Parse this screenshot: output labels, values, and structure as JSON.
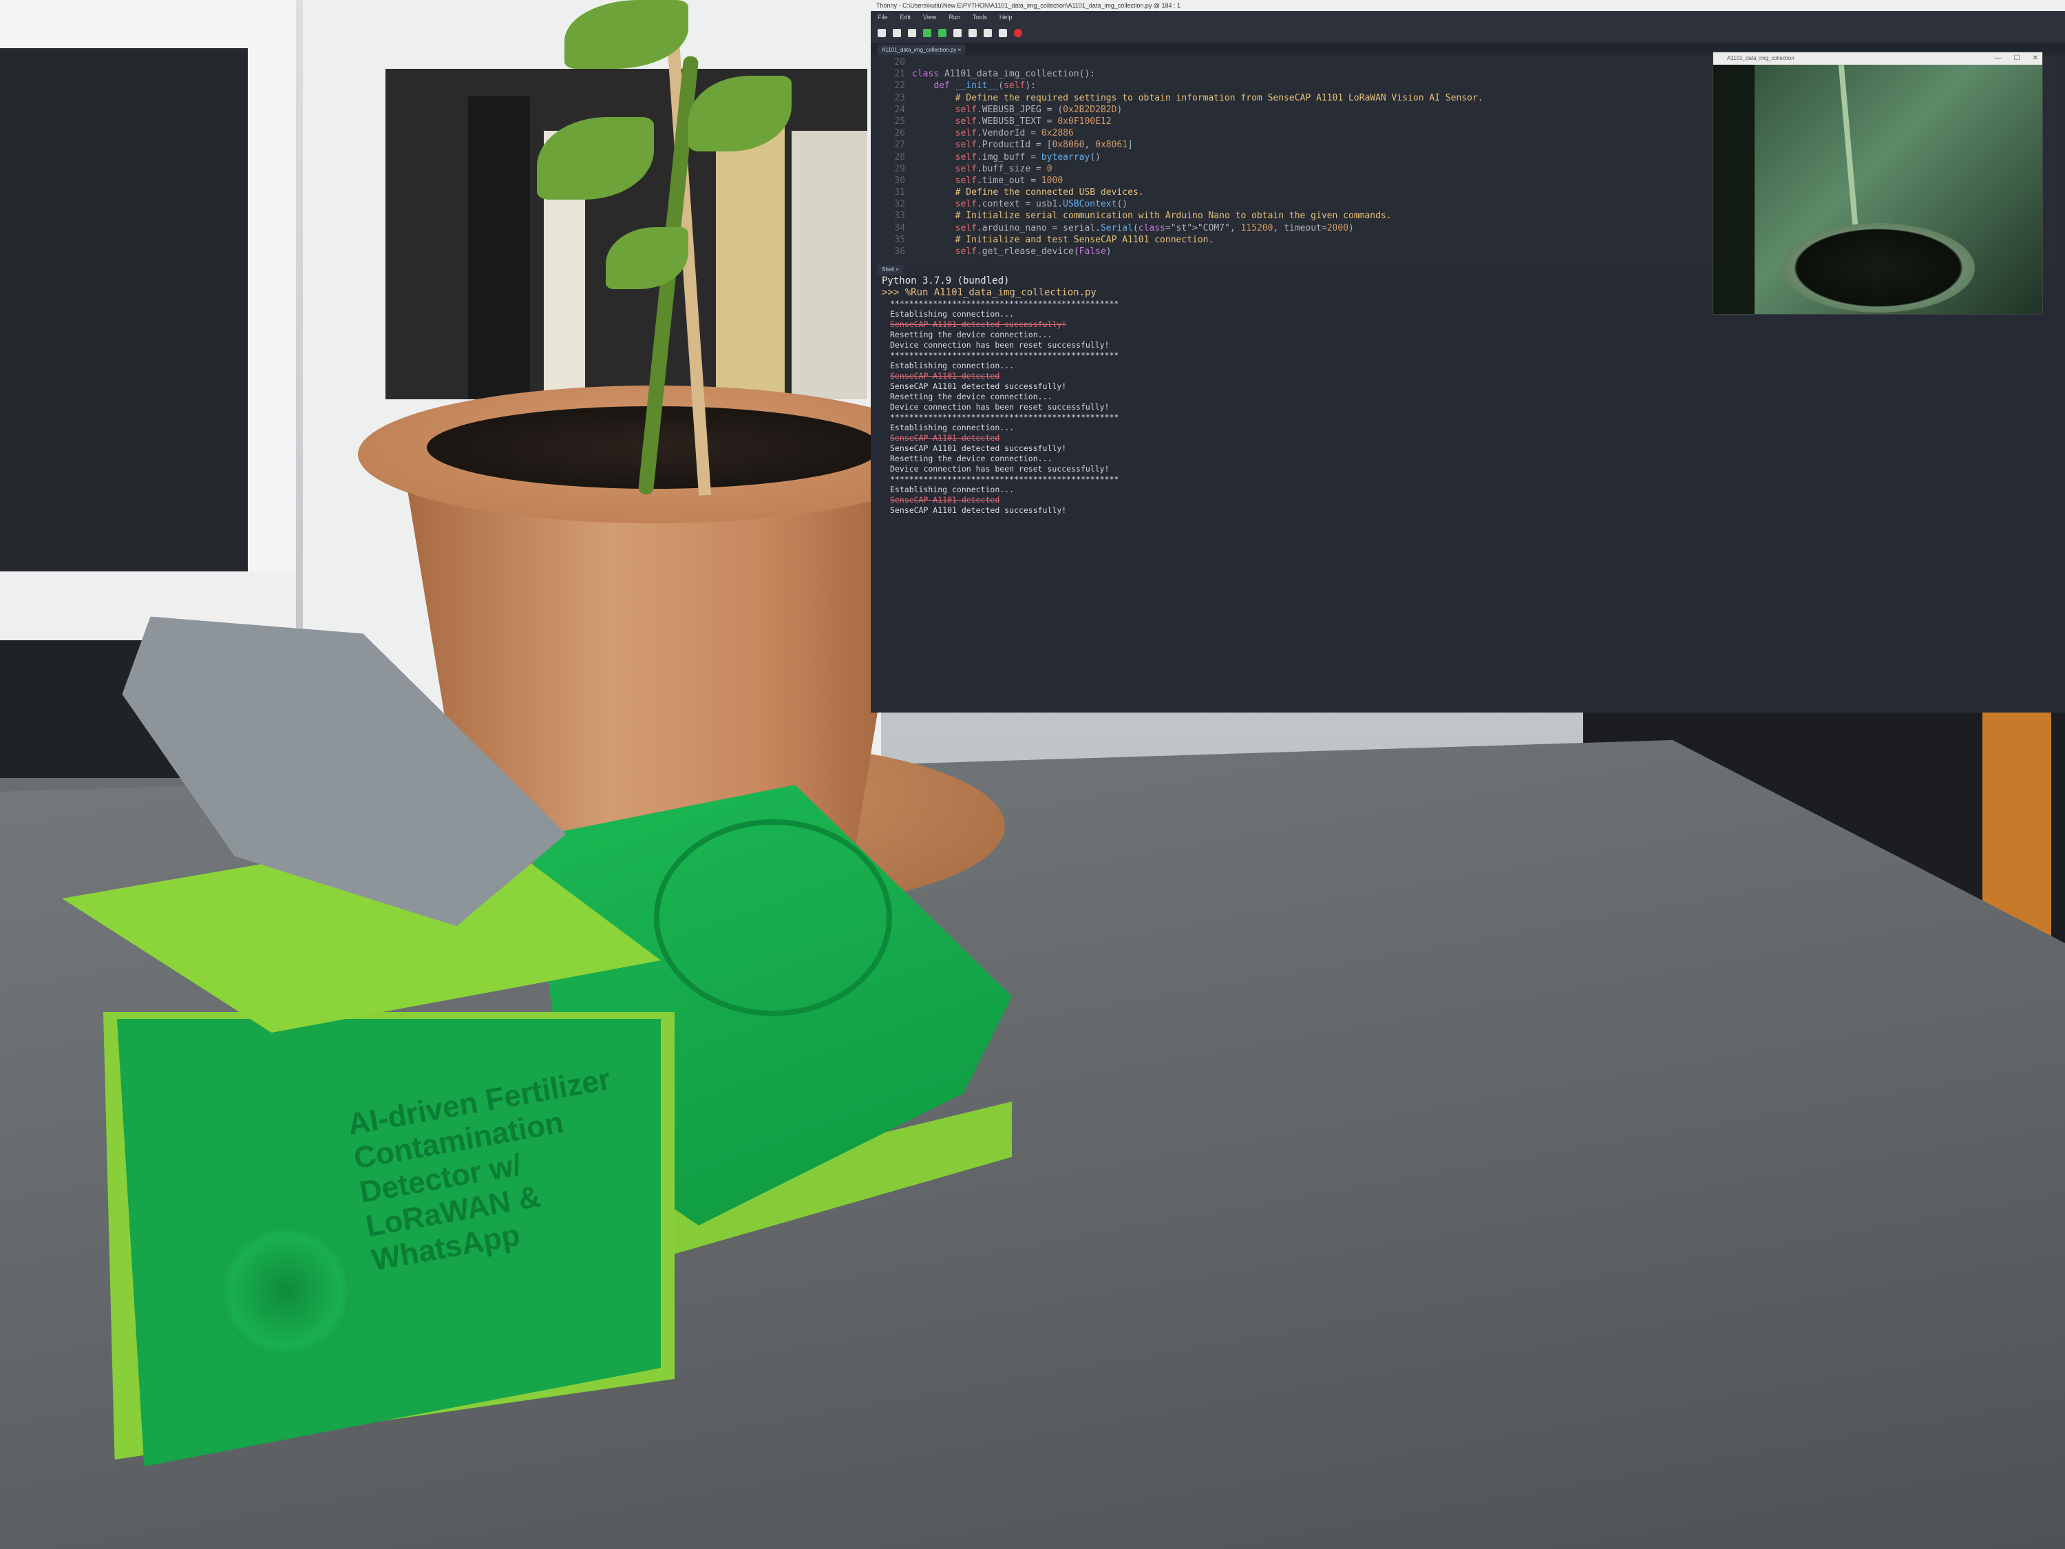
{
  "ide": {
    "title": "Thonny  -  C:\\Users\\kutlu\\New E\\PYTHON\\A1101_data_img_collection\\A1101_data_img_collection.py  @  184 : 1",
    "menu": [
      "File",
      "Edit",
      "View",
      "Run",
      "Tools",
      "Help"
    ],
    "file_tab": "A1101_data_img_collection.py ×",
    "shell_tab": "Shell ×",
    "code_lines": [
      {
        "n": "20",
        "text": ""
      },
      {
        "n": "21",
        "text": "class A1101_data_img_collection():"
      },
      {
        "n": "22",
        "text": "    def __init__(self):"
      },
      {
        "n": "23",
        "text": "        # Define the required settings to obtain information from SenseCAP A1101 LoRaWAN Vision AI Sensor."
      },
      {
        "n": "24",
        "text": "        self.WEBUSB_JPEG = (0x2B2D2B2D)"
      },
      {
        "n": "25",
        "text": "        self.WEBUSB_TEXT = 0x0F100E12"
      },
      {
        "n": "26",
        "text": "        self.VendorId = 0x2886"
      },
      {
        "n": "27",
        "text": "        self.ProductId = [0x8060, 0x8061]"
      },
      {
        "n": "28",
        "text": "        self.img_buff = bytearray()"
      },
      {
        "n": "29",
        "text": "        self.buff_size = 0"
      },
      {
        "n": "30",
        "text": "        self.time_out = 1000"
      },
      {
        "n": "31",
        "text": "        # Define the connected USB devices."
      },
      {
        "n": "32",
        "text": "        self.context = usb1.USBContext()"
      },
      {
        "n": "33",
        "text": "        # Initialize serial communication with Arduino Nano to obtain the given commands."
      },
      {
        "n": "34",
        "text": "        self.arduino_nano = serial.Serial(\"COM7\", 115200, timeout=2000)"
      },
      {
        "n": "35",
        "text": "        # Initialize and test SenseCAP A1101 connection."
      },
      {
        "n": "36",
        "text": "        self.get_rlease_device(False)"
      }
    ],
    "shell": {
      "header": "Python 3.7.9 (bundled)",
      "command": ">>> %Run A1101_data_img_collection.py",
      "lines": [
        {
          "kind": "out",
          "text": "************************************************"
        },
        {
          "kind": "out",
          "text": "Establishing connection..."
        },
        {
          "kind": "err",
          "text": "SenseCAP A1101 detected successfully!"
        },
        {
          "kind": "out",
          "text": "Resetting the device connection..."
        },
        {
          "kind": "out",
          "text": "Device connection has been reset successfully!"
        },
        {
          "kind": "out",
          "text": "************************************************"
        },
        {
          "kind": "out",
          "text": "Establishing connection..."
        },
        {
          "kind": "err",
          "text": "SenseCAP A1101 detected"
        },
        {
          "kind": "out",
          "text": "SenseCAP A1101 detected successfully!"
        },
        {
          "kind": "out",
          "text": "Resetting the device connection..."
        },
        {
          "kind": "out",
          "text": "Device connection has been reset successfully!"
        },
        {
          "kind": "out",
          "text": "************************************************"
        },
        {
          "kind": "out",
          "text": "Establishing connection..."
        },
        {
          "kind": "err",
          "text": "SenseCAP A1101 detected"
        },
        {
          "kind": "out",
          "text": "SenseCAP A1101 detected successfully!"
        },
        {
          "kind": "out",
          "text": "Resetting the device connection..."
        },
        {
          "kind": "out",
          "text": "Device connection has been reset successfully!"
        },
        {
          "kind": "out",
          "text": "************************************************"
        },
        {
          "kind": "out",
          "text": "Establishing connection..."
        },
        {
          "kind": "err",
          "text": "SenseCAP A1101 detected"
        },
        {
          "kind": "out",
          "text": "SenseCAP A1101 detected successfully!"
        }
      ]
    }
  },
  "camera_window": {
    "title": "A1101_data_img_collection",
    "controls": [
      "—",
      "☐",
      "✕"
    ]
  },
  "device_label": "AI-driven Fertilizer Contamination Detector w/ LoRaWAN & WhatsApp",
  "colors": {
    "ide_bg": "#262b36",
    "device_green": "#16a548",
    "device_lime": "#8bd43a",
    "sensor_gray": "#8d949a"
  }
}
